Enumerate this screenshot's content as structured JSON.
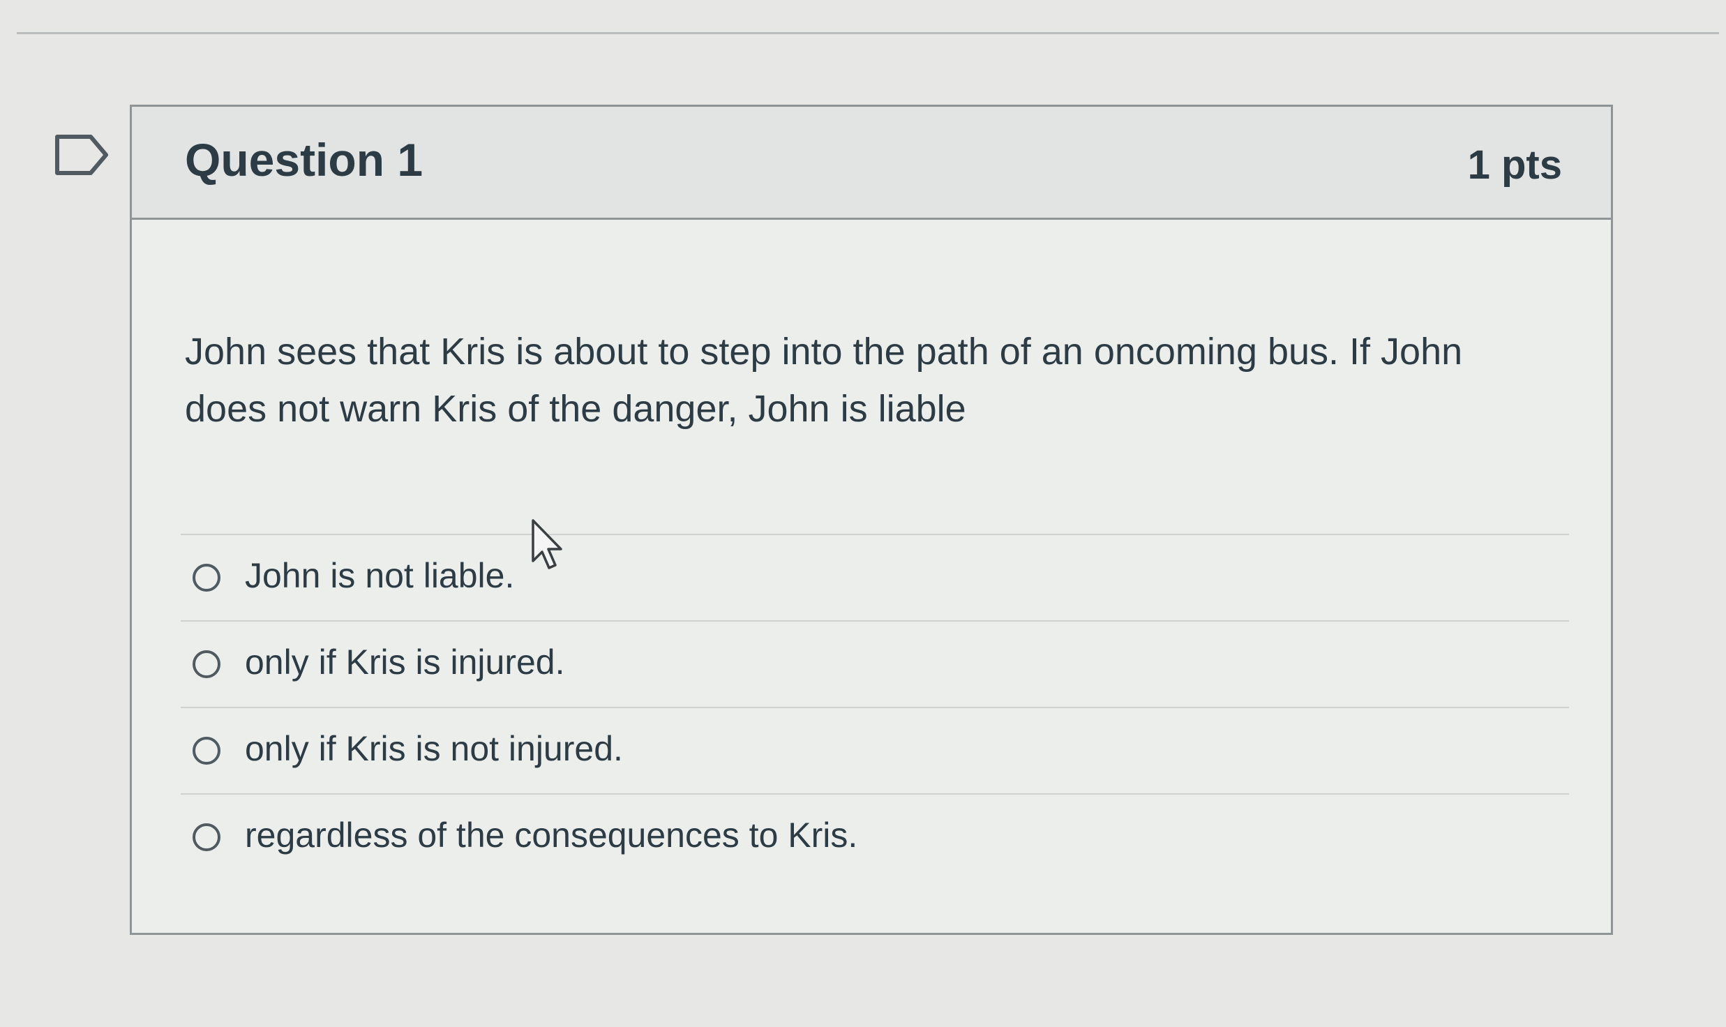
{
  "question": {
    "title": "Question 1",
    "points": "1 pts",
    "text": "John sees that Kris is about to step into the path of an oncoming bus. If John does not warn Kris of the danger, John is liable",
    "flag_icon": "flag-outline-icon"
  },
  "answers": [
    {
      "label": "John is not liable.",
      "selected": false
    },
    {
      "label": "only if Kris is injured.",
      "selected": false
    },
    {
      "label": "only if Kris is not injured.",
      "selected": false
    },
    {
      "label": "regardless of the consequences to Kris.",
      "selected": false
    }
  ],
  "pointer_icon": "mouse-pointer-icon",
  "colors": {
    "text": "#2d3b45",
    "border": "#8f9496",
    "background": "#e7e8e6"
  }
}
